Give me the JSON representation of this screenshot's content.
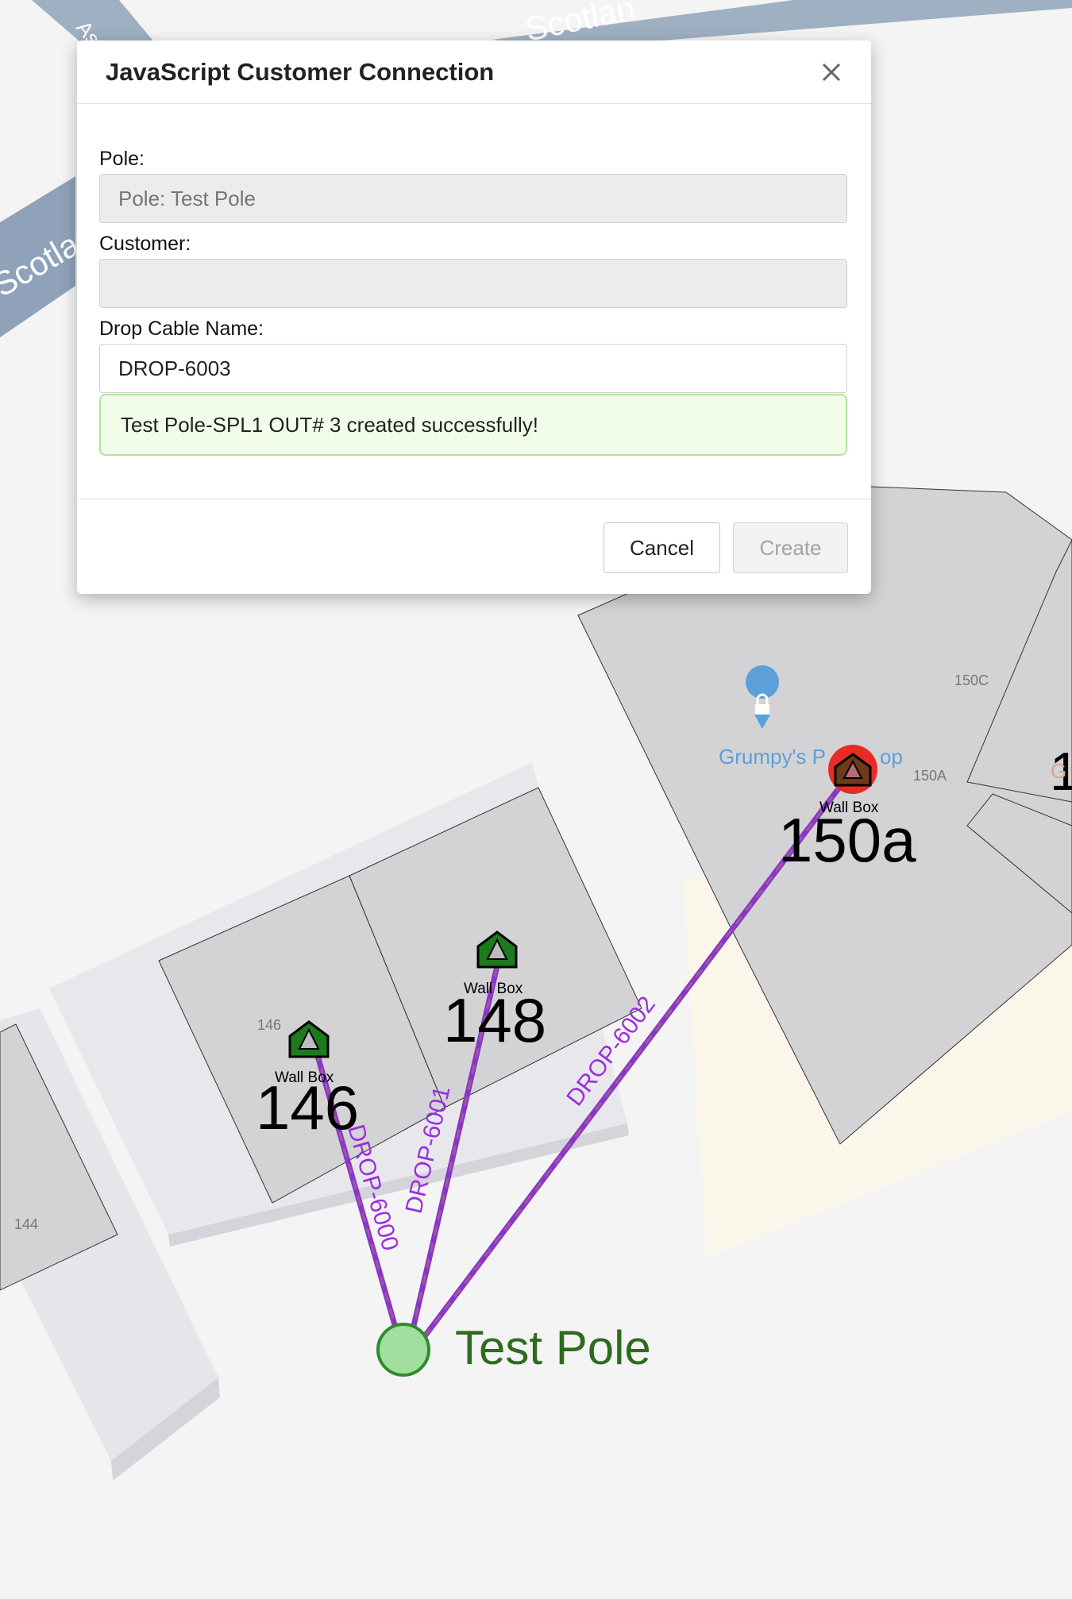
{
  "modal": {
    "title": "JavaScript Customer Connection",
    "pole_label": "Pole:",
    "pole_placeholder": "Pole: Test Pole",
    "pole_value": "",
    "customer_label": "Customer:",
    "customer_value": "",
    "drop_cable_label": "Drop Cable Name:",
    "drop_cable_value": "DROP-6003",
    "success_message": "Test Pole-SPL1 OUT# 3 created successfully!",
    "cancel_label": "Cancel",
    "create_label": "Create",
    "close_icon": "close-icon"
  },
  "map": {
    "streets": [
      "Scotlan",
      "Scotlan",
      "Ast"
    ],
    "poi_name": "Grumpy's P",
    "poi_name_tail": "op",
    "poi_icon": "lock-pin-icon",
    "lot_numbers": [
      "146",
      "144",
      "150C",
      "150A",
      "1",
      "G"
    ],
    "wall_box_label": "Wall Box",
    "wall_box_icon": "wall-box-icon",
    "addresses": [
      "146",
      "148",
      "150a"
    ],
    "drops": [
      "DROP-6000",
      "DROP-6001",
      "DROP-6002"
    ],
    "pole_name": "Test Pole",
    "colors": {
      "drop_line": "#8a35c8",
      "drop_label": "#9b2fe0",
      "pole_fill": "#a3dea1",
      "pole_stroke": "#2e8b2e",
      "pole_label": "#2e6b1e",
      "wall_box_fill": "#1d7a1d",
      "selected_ring": "#e8231c",
      "poi": "#5d9fd9"
    }
  }
}
